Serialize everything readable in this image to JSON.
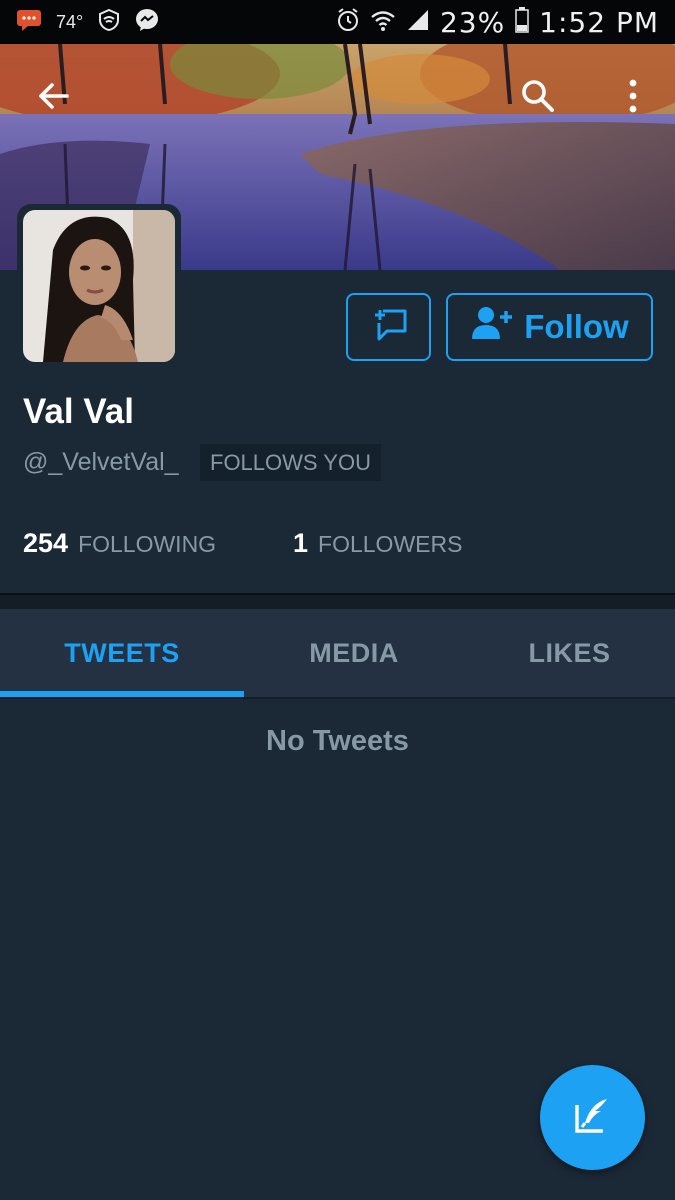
{
  "status_bar": {
    "temperature": "74°",
    "battery_percent": "23%",
    "time": "1:52 PM",
    "left_icons": [
      "notification-chat-icon",
      "wifi-shield-icon",
      "messenger-icon"
    ],
    "right_icons": [
      "alarm-icon",
      "wifi-icon",
      "signal-icon",
      "battery-icon"
    ]
  },
  "header": {
    "back_icon": "arrow-left-icon",
    "search_icon": "search-icon",
    "menu_icon": "more-vertical-icon"
  },
  "profile": {
    "display_name": "Val Val",
    "handle": "@_VelvetVal_",
    "follows_you_badge": "FOLLOWS YOU",
    "following_count": "254",
    "following_label": "FOLLOWING",
    "followers_count": "1",
    "followers_label": "FOLLOWERS"
  },
  "actions": {
    "message_icon": "direct-message-icon",
    "follow_icon": "add-person-icon",
    "follow_label": "Follow"
  },
  "tabs": [
    {
      "label": "TWEETS",
      "active": true
    },
    {
      "label": "MEDIA",
      "active": false
    },
    {
      "label": "LIKES",
      "active": false
    }
  ],
  "content": {
    "empty_text": "No Tweets"
  },
  "fab": {
    "icon": "compose-tweet-icon"
  },
  "colors": {
    "accent": "#1da1f2",
    "background": "#1b2836",
    "muted_text": "#8899a6"
  }
}
